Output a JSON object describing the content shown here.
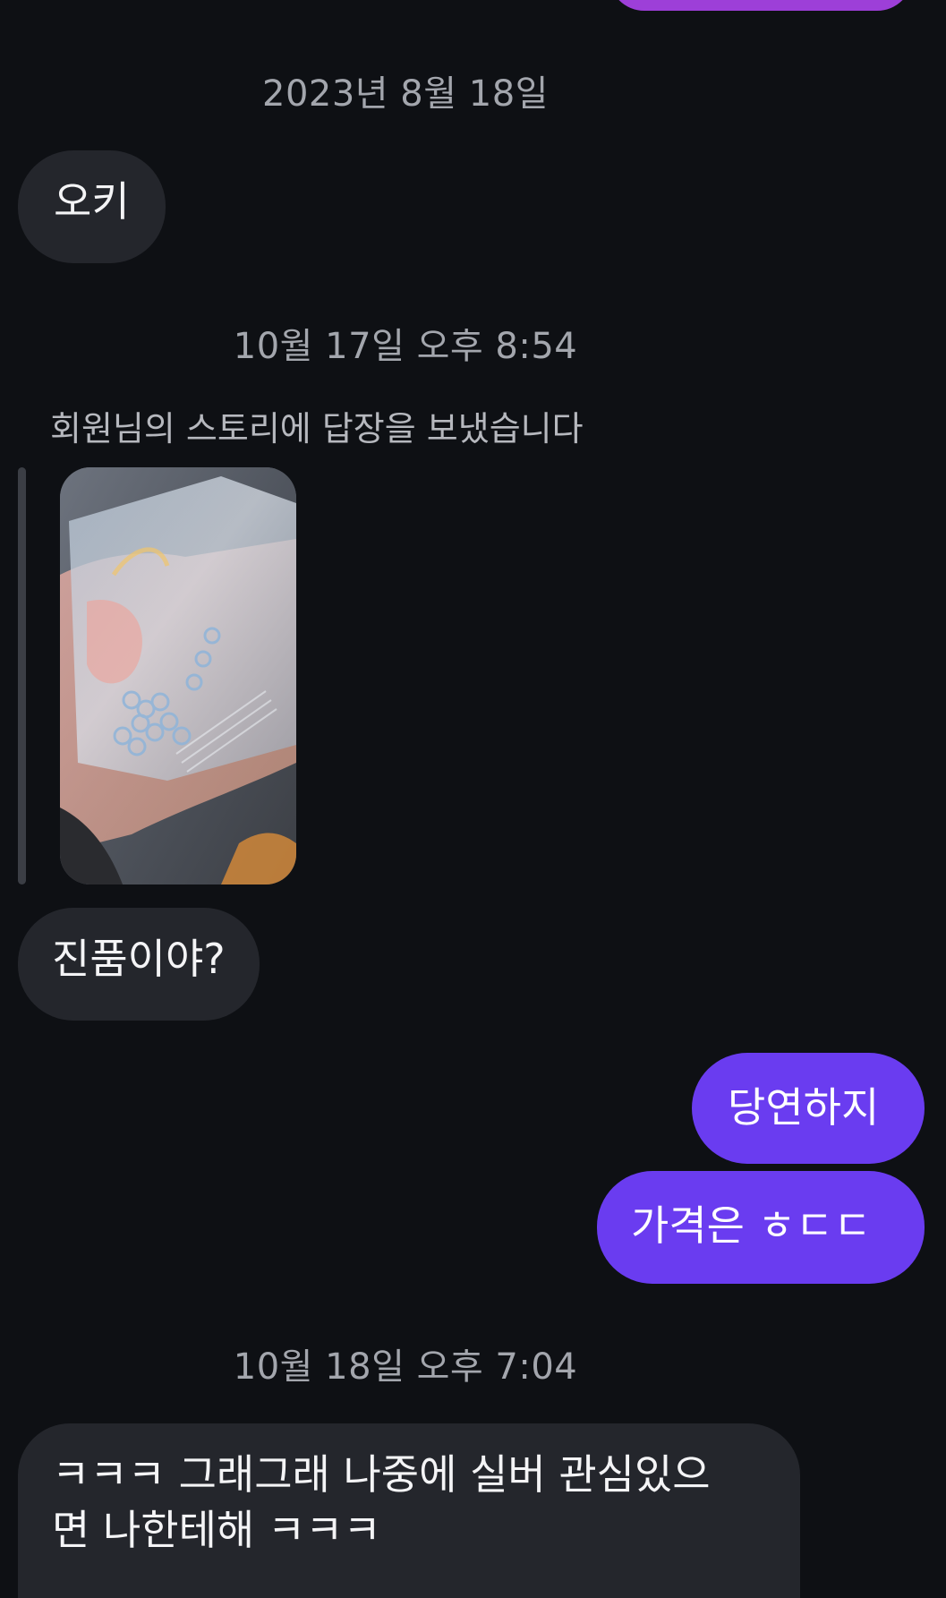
{
  "messages": {
    "date_1": "2023년 8월 18일",
    "m1": "오키",
    "date_2": "10월 17일 오후 8:54",
    "reply_note": "회원님의 스토리에 답장을 보냈습니다",
    "m2": "진품이야?",
    "m3": "당연하지",
    "m4": "가격은 ㅎㄷㄷ",
    "date_3": "10월 18일 오후 7:04",
    "m5_line1": "ㅋㅋㅋ 그래그래 나중에 실버 관심있으",
    "m5_line2": "면 나한테해 ㅋㅋㅋ"
  },
  "colors": {
    "background": "#0e1014",
    "incoming_bubble": "#24262c",
    "outgoing_bubble": "#6a3cf0",
    "top_bubble": "#9d3fd8",
    "timestamp_text": "#a3a6ad"
  },
  "story_image": {
    "description_icon": "story-photo-icon"
  }
}
